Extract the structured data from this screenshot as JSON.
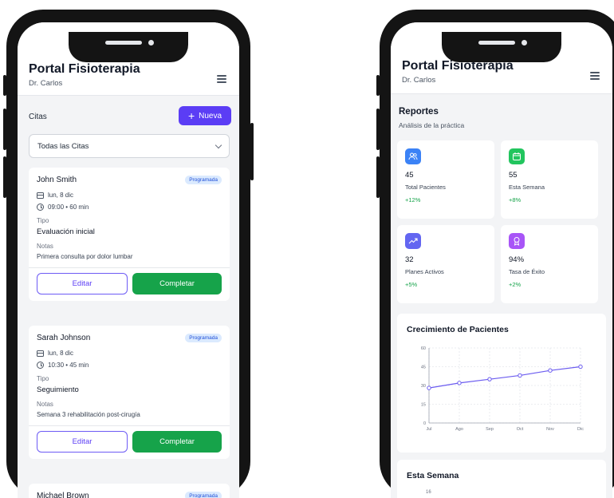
{
  "app": {
    "title": "Portal Fisioterapia",
    "user": "Dr. Carlos"
  },
  "left": {
    "section_label": "Citas",
    "new_button": {
      "icon": "plus-icon",
      "label": "Nueva"
    },
    "filter": {
      "selected": "Todas las Citas"
    },
    "appointments": [
      {
        "name": "John Smith",
        "status": "Programada",
        "date": "lun, 8 dic",
        "time": "09:00 • 60 min",
        "type_label": "Tipo",
        "type": "Evaluación inicial",
        "notes_label": "Notas",
        "notes": "Primera consulta por dolor lumbar",
        "edit_label": "Editar",
        "complete_label": "Completar"
      },
      {
        "name": "Sarah Johnson",
        "status": "Programada",
        "date": "lun, 8 dic",
        "time": "10:30 • 45 min",
        "type_label": "Tipo",
        "type": "Seguimiento",
        "notes_label": "Notas",
        "notes": "Semana 3 rehabilitación post-cirugía",
        "edit_label": "Editar",
        "complete_label": "Completar"
      },
      {
        "name": "Michael Brown",
        "status": "Programada"
      }
    ]
  },
  "right": {
    "title": "Reportes",
    "subtitle": "Análisis de la práctica",
    "stats": [
      {
        "icon": "users-icon",
        "value": "45",
        "label": "Total Pacientes",
        "change": "+12%",
        "color": "#3b82f6"
      },
      {
        "icon": "calendar-icon",
        "value": "55",
        "label": "Esta Semana",
        "change": "+8%",
        "color": "#22c55e"
      },
      {
        "icon": "trending-up-icon",
        "value": "32",
        "label": "Planes Activos",
        "change": "+5%",
        "color": "#6366f1"
      },
      {
        "icon": "award-icon",
        "value": "94%",
        "label": "Tasa de Éxito",
        "change": "+2%",
        "color": "#a855f7"
      }
    ],
    "week_title": "Esta Semana",
    "week_first_tick": "16"
  },
  "chart_data": {
    "type": "line",
    "title": "Crecimiento de Pacientes",
    "categories": [
      "Jul",
      "Ago",
      "Sep",
      "Oct",
      "Nov",
      "Dic"
    ],
    "values": [
      28,
      32,
      35,
      38,
      42,
      45
    ],
    "ylim": [
      0,
      60
    ],
    "yticks": [
      0,
      15,
      30,
      45,
      60
    ],
    "grid": true,
    "color": "#6b5cf0"
  },
  "colors": {
    "primary": "#5b3df5",
    "success": "#16a34a",
    "badge_bg": "#dbeafe",
    "badge_text": "#1d4ed8"
  }
}
